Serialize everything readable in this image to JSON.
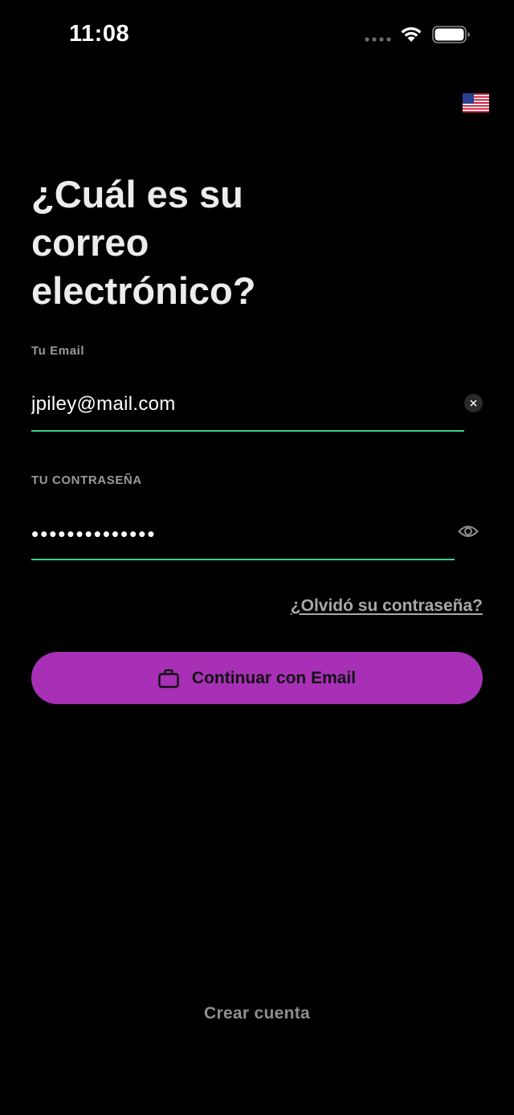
{
  "status_bar": {
    "time": "11:08"
  },
  "language": {
    "flag": "🇺🇸",
    "flag_icon": "us-flag-icon"
  },
  "title": "¿Cuál es su correo electrónico?",
  "email_field": {
    "label": "Tu Email",
    "value": "jpiley@mail.com",
    "clear_icon": "close-icon"
  },
  "password_field": {
    "label": "TU CONTRASEÑA",
    "value": "••••••••••••••",
    "visibility_icon": "eye-icon"
  },
  "forgot_password": "¿Olvidó su contraseña?",
  "continue_button": {
    "label": "Continuar con Email",
    "icon": "briefcase-icon"
  },
  "create_account": "Crear cuenta",
  "colors": {
    "background": "#000000",
    "accent": "#a730b6",
    "input_underline": "#3ecf8e",
    "muted_text": "#9a9a9a"
  }
}
